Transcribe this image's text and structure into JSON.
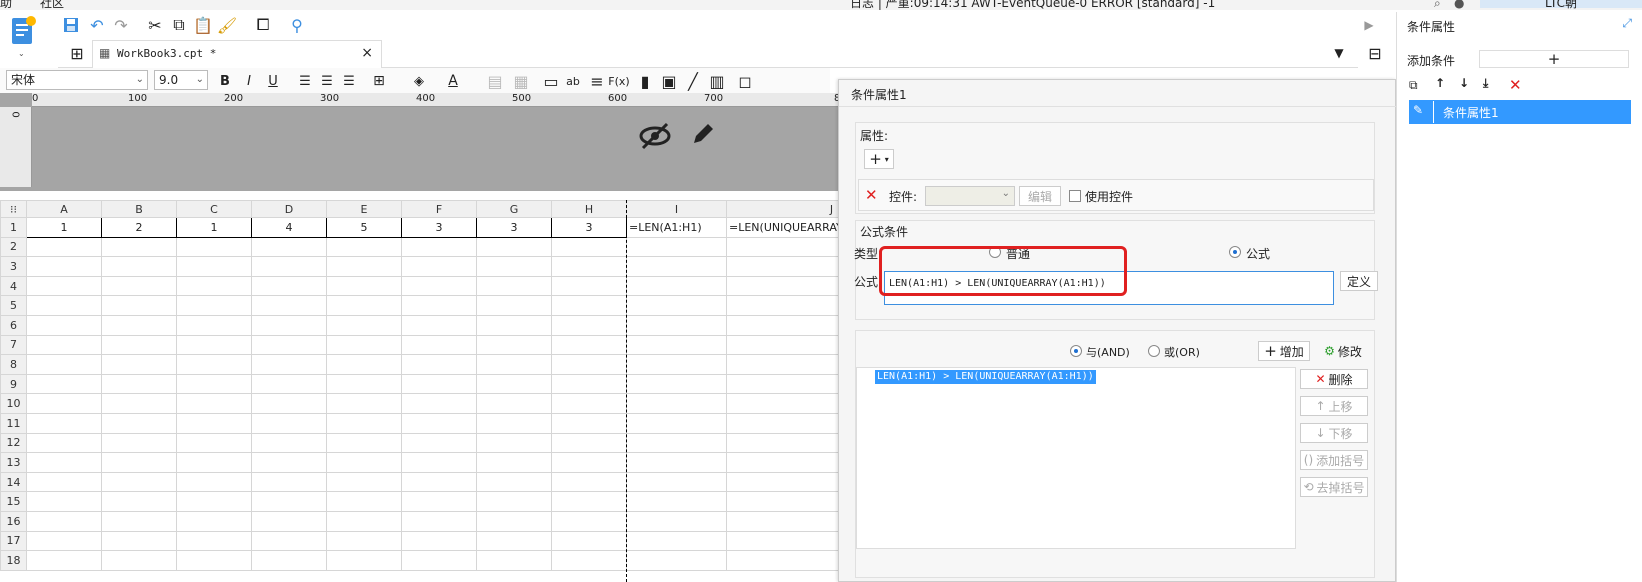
{
  "topbar": {
    "help_label": "助",
    "community_label": "社区",
    "log_text": "日志 | 严重:09:14:31 AWT-EventQueue-0 ERROR [standard] -1",
    "user_text": "LTC朝"
  },
  "workbook_tab": {
    "title": "WorkBook3.cpt *",
    "close": "×"
  },
  "format_bar": {
    "font_name": "宋体",
    "font_size": "9.0",
    "bold": "B",
    "italic": "I",
    "underline": "U",
    "text_color_glyph": "A",
    "ab_label": "ab",
    "fx_label": "F(x)"
  },
  "ruler": {
    "ticks": [
      "0",
      "100",
      "200",
      "300",
      "400",
      "500",
      "600",
      "700",
      "8"
    ],
    "left_tick": "0"
  },
  "sheet": {
    "columns": [
      "A",
      "B",
      "C",
      "D",
      "E",
      "F",
      "G",
      "H",
      "I",
      "J"
    ],
    "row_numbers": [
      "1",
      "2",
      "3",
      "4",
      "5",
      "6",
      "7",
      "8",
      "9",
      "10",
      "11",
      "12",
      "13",
      "14",
      "15",
      "16",
      "17",
      "18"
    ],
    "row1": [
      "1",
      "2",
      "1",
      "4",
      "5",
      "3",
      "3",
      "3",
      "=LEN(A1:H1)",
      "=LEN(UNIQUEARRAY"
    ]
  },
  "dialog": {
    "title": "条件属性1",
    "property_label": "属性:",
    "add_glyph": "+",
    "control_label": "控件:",
    "edit_button": "编辑",
    "use_control_label": "使用控件",
    "formula_condition_label": "公式条件",
    "type_label": "类型:",
    "type_normal": "普通",
    "type_formula": "公式",
    "formula_label": "公式:",
    "formula_value": "LEN(A1:H1) > LEN(UNIQUEARRAY(A1:H1))",
    "define_button": "定义",
    "and_label": "与(AND)",
    "or_label": "或(OR)",
    "add_button": "增加",
    "modify_button": "修改",
    "condition_item": "LEN(A1:H1) > LEN(UNIQUEARRAY(A1:H1))",
    "delete_button": "删除",
    "move_up_button": "上移",
    "move_down_button": "下移",
    "add_bracket_button": "添加括号",
    "remove_bracket_button": "去掉括号"
  },
  "right_panel": {
    "title": "条件属性",
    "add_condition_label": "添加条件",
    "add_glyph": "+",
    "list_item": "条件属性1"
  },
  "colors": {
    "accent": "#3d8fe0",
    "highlight_red": "#e02020",
    "selection_blue": "#3399ff"
  }
}
